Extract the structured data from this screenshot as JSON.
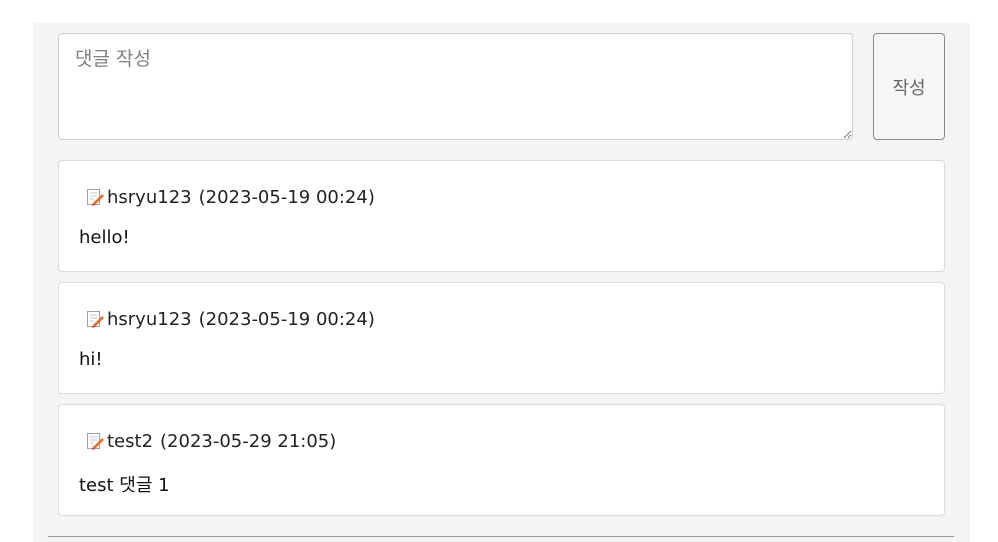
{
  "form": {
    "placeholder": "댓글 작성",
    "submit_label": "작성"
  },
  "comments": [
    {
      "author": "hsryu123",
      "time": "(2023-05-19 00:24)",
      "text": "hello!"
    },
    {
      "author": "hsryu123",
      "time": "(2023-05-19 00:24)",
      "text": "hi!"
    },
    {
      "author": "test2",
      "time": "(2023-05-29 21:05)",
      "text": "test 댓글 1"
    }
  ],
  "icons": {
    "comment_author": "memo-icon"
  },
  "colors": {
    "panel_bg": "#f4f4f4",
    "card_border": "#dcdcdc",
    "icon_accent": "#e8702a"
  }
}
